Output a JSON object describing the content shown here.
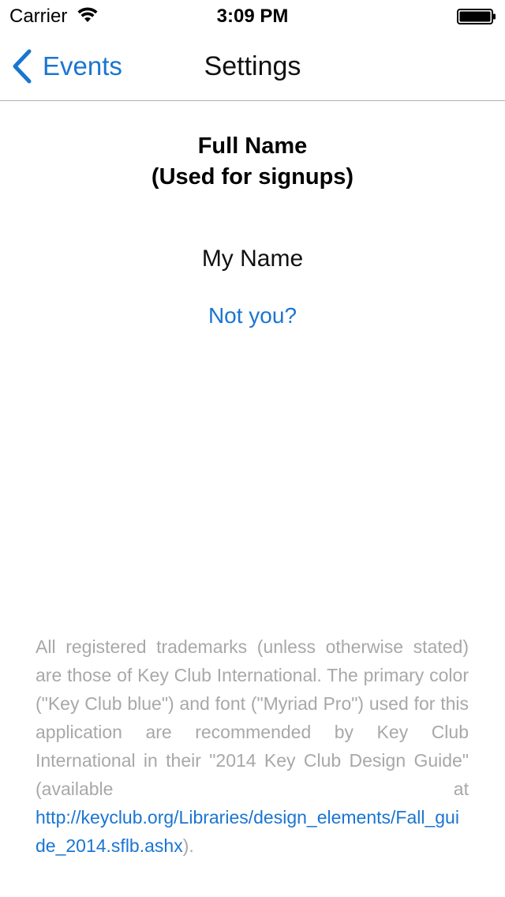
{
  "status_bar": {
    "carrier": "Carrier",
    "time": "3:09 PM",
    "wifi_icon": "wifi-icon",
    "battery_icon": "battery-full-icon"
  },
  "nav": {
    "back_label": "Events",
    "back_icon": "chevron-left-icon",
    "title": "Settings"
  },
  "profile": {
    "heading_line1": "Full Name",
    "heading_line2": "(Used for signups)",
    "name": "My Name",
    "not_you_label": "Not you?"
  },
  "footer": {
    "text_before_link": "All registered trademarks (unless otherwise stated) are those of Key Club International. The primary color (\"Key Club blue\") and font (\"Myriad Pro\") used for this application are recommended by Key Club International in their \"2014 Key Club Design Guide\" (available at ",
    "link_text": "http://keyclub.org/Libraries/design_elements/Fall_guide_2014.sflb.ashx",
    "text_after_link": ")."
  },
  "colors": {
    "accent": "#1a75d2",
    "footer_text": "#a8a8a8",
    "separator": "#b2b2b2"
  }
}
